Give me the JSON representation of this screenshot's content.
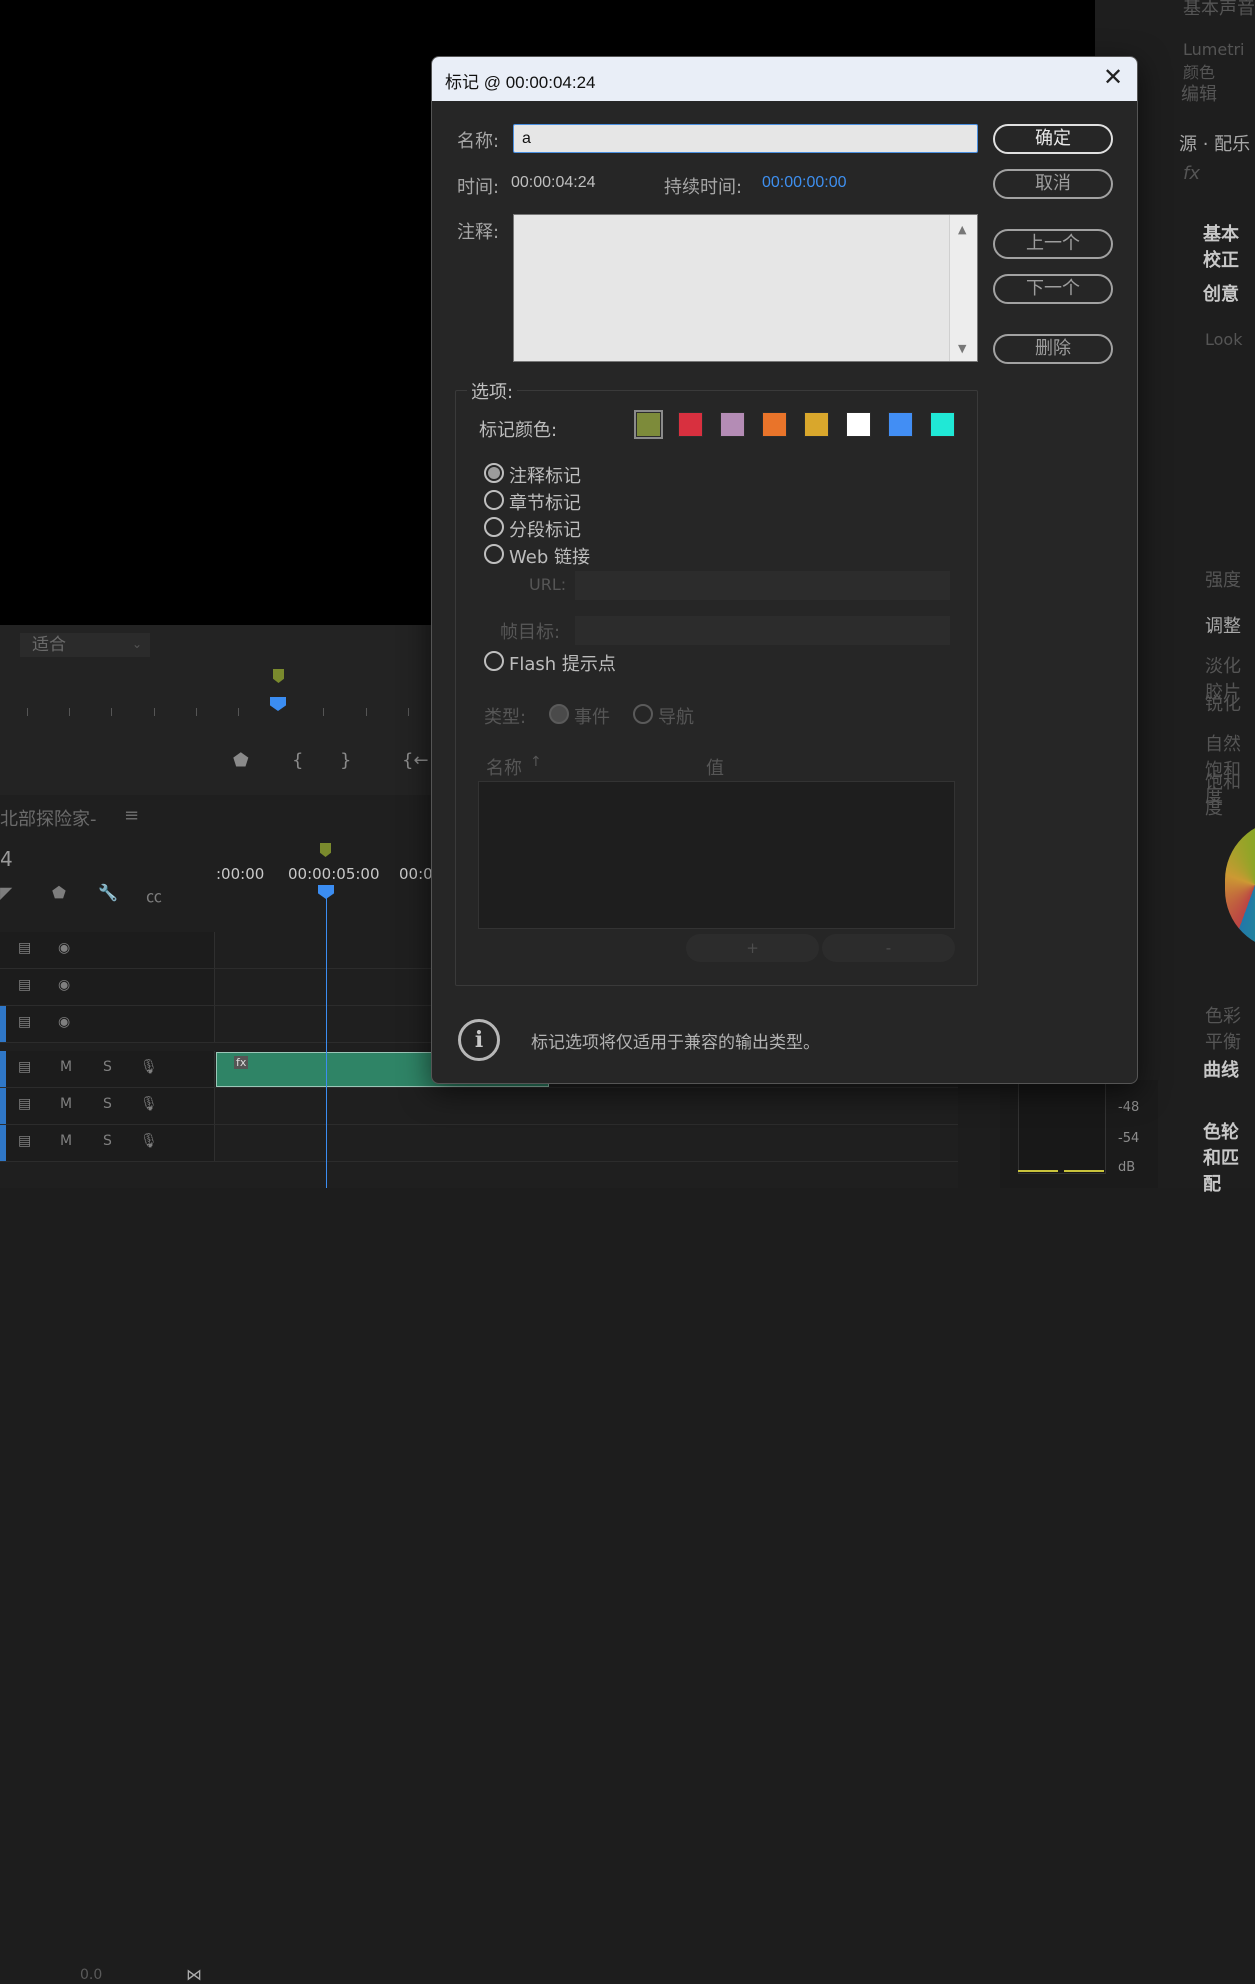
{
  "background": {
    "monitor": {
      "fit_label": "适合"
    },
    "timeline": {
      "sequence_tab": "北部探险家-",
      "menu_icon": "≡",
      "timecode": "4",
      "timestamps": [
        ":00:00",
        "00:00:05:00",
        "00:0"
      ],
      "track_labels": {
        "mute": "M",
        "solo": "S"
      },
      "zoom_value": "0.0"
    },
    "right_panel": {
      "items": [
        "基本声音",
        "Lumetri 颜色",
        "编辑",
        "源 · 配乐",
        "fx",
        "基本校正",
        "创意",
        "Look",
        "强度",
        "调整",
        "淡化胶片",
        "锐化",
        "自然饱和度",
        "饱和度",
        "色彩平衡",
        "曲线",
        "色轮和匹配"
      ],
      "meter_labels": [
        "-48",
        "-54",
        "dB"
      ]
    }
  },
  "dialog": {
    "title": "标记 @ 00:00:04:24",
    "name_label": "名称:",
    "name_value": "a",
    "time_label": "时间:",
    "time_value": "00:00:04:24",
    "duration_label": "持续时间:",
    "duration_value": "00:00:00:00",
    "comment_label": "注释:",
    "buttons": {
      "ok": "确定",
      "cancel": "取消",
      "prev": "上一个",
      "next": "下一个",
      "delete": "删除"
    },
    "options": {
      "legend": "选项:",
      "color_label": "标记颜色:",
      "colors": [
        "#7d8b3a",
        "#d8303f",
        "#b48cb5",
        "#e9742a",
        "#d9a72c",
        "#ffffff",
        "#428ef4",
        "#20e8d6"
      ],
      "selected_color_index": 0,
      "marker_types": [
        {
          "label": "注释标记",
          "selected": true
        },
        {
          "label": "章节标记",
          "selected": false
        },
        {
          "label": "分段标记",
          "selected": false
        },
        {
          "label": "Web 链接",
          "selected": false
        }
      ],
      "url_label": "URL:",
      "frame_target_label": "帧目标:",
      "flash_label": "Flash 提示点",
      "type_label": "类型:",
      "type_event": "事件",
      "type_nav": "导航",
      "table_col_name": "名称",
      "table_col_value": "值",
      "add_btn": "+",
      "remove_btn": "-"
    },
    "info_text": "标记选项将仅适用于兼容的输出类型。"
  }
}
